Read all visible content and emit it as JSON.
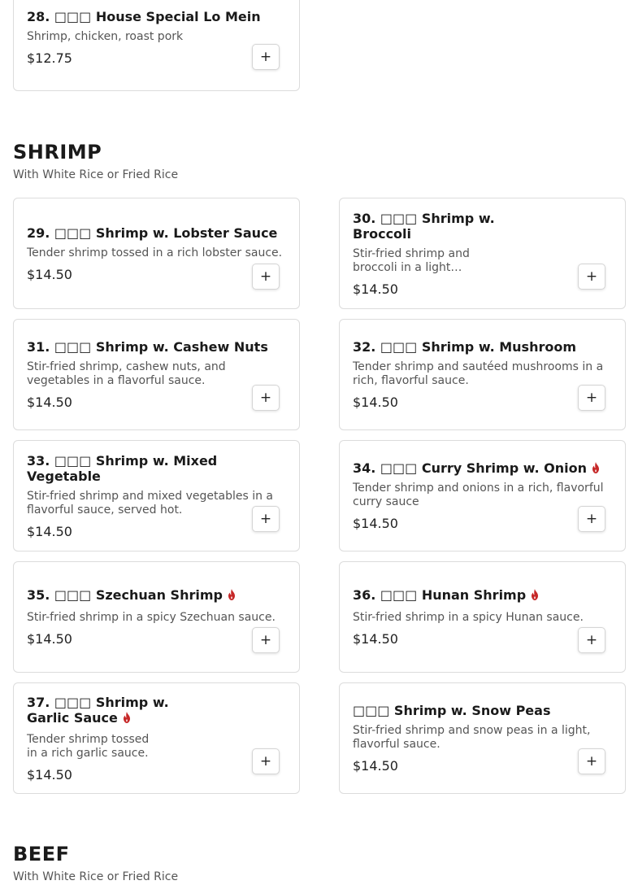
{
  "sections": {
    "noodle": {
      "items": [
        {
          "name": "28. □□□ House Special Lo Mein",
          "desc": "Shrimp, chicken, roast pork",
          "price": "$12.75"
        }
      ]
    },
    "shrimp": {
      "title": "SHRIMP",
      "subtitle": "With White Rice or Fried Rice",
      "items": [
        {
          "name": "29. □□□ Shrimp w. Lobster Sauce",
          "desc": "Tender shrimp tossed in a rich lobster sauce.",
          "price": "$14.50"
        },
        {
          "name": "30. □□□ Shrimp w. Broccoli",
          "desc": "Stir-fried shrimp and broccoli in a light…",
          "price": "$14.50"
        },
        {
          "name": "31. □□□ Shrimp w. Cashew Nuts",
          "desc": "Stir-fried shrimp, cashew nuts, and vegetables in a flavorful sauce.",
          "price": "$14.50"
        },
        {
          "name": "32. □□□ Shrimp w. Mushroom",
          "desc": "Tender shrimp and sautéed mushrooms in a rich, flavorful sauce.",
          "price": "$14.50"
        },
        {
          "name": "33. □□□ Shrimp w. Mixed Vegetable",
          "desc": "Stir-fried shrimp and mixed vegetables in a flavorful sauce, served hot.",
          "price": "$14.50"
        },
        {
          "name": "34. □□□ Curry Shrimp w. Onion",
          "desc": "Tender shrimp and onions in a rich, flavorful curry sauce",
          "price": "$14.50"
        },
        {
          "name": "35. □□□ Szechuan Shrimp",
          "desc": "Stir-fried shrimp in a spicy Szechuan sauce.",
          "price": "$14.50"
        },
        {
          "name": "36. □□□ Hunan Shrimp",
          "desc": "Stir-fried shrimp in a spicy Hunan sauce.",
          "price": "$14.50"
        },
        {
          "name": "37. □□□ Shrimp w. Garlic Sauce",
          "desc": "Tender shrimp tossed in a rich garlic sauce.",
          "price": "$14.50"
        },
        {
          "name": "□□□ Shrimp w. Snow Peas",
          "desc": "Stir-fried shrimp and snow peas in a light, flavorful sauce.",
          "price": "$14.50"
        }
      ]
    },
    "beef": {
      "title": "BEEF",
      "subtitle": "With White Rice or Fried Rice"
    }
  },
  "add_button_label": "+",
  "spicy_icon": "fire-icon",
  "colors": {
    "spicy": "#c62828",
    "border": "#dcdcdc"
  }
}
